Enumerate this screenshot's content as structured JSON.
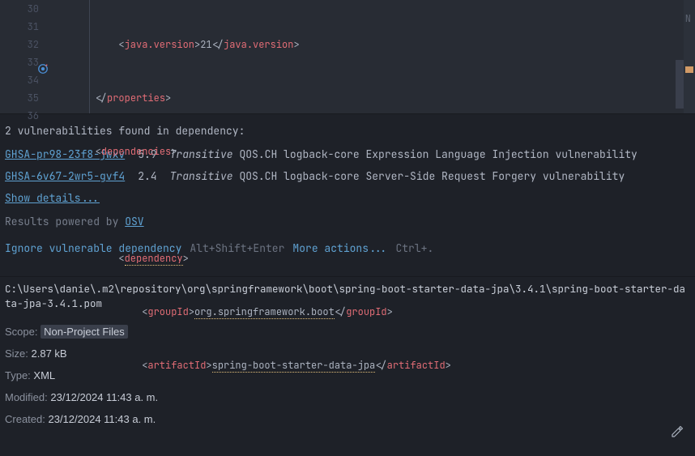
{
  "editor": {
    "lines": [
      {
        "num": "30"
      },
      {
        "num": "31"
      },
      {
        "num": "32"
      },
      {
        "num": "33"
      },
      {
        "num": "34"
      },
      {
        "num": "35"
      },
      {
        "num": "36"
      }
    ],
    "code": {
      "line31_tag": "properties",
      "line32_tag": "dependencies",
      "line34_tag": "dependency",
      "line35_tag": "groupId",
      "line35_text": "org.springframework.boot",
      "line36_tag": "artifactId",
      "line36_text": "spring-boot-starter-data-jpa"
    },
    "miniLabel": "N"
  },
  "vulnerability": {
    "header": "2 vulnerabilities found in dependency:",
    "items": [
      {
        "id": "GHSA-pr98-23f8-jwxv",
        "score": "5.9",
        "transitive": "Transitive",
        "desc": "QOS.CH logback-core Expression Language Injection vulnerability"
      },
      {
        "id": "GHSA-6v67-2wr5-gvf4",
        "score": "2.4",
        "transitive": "Transitive",
        "desc": "QOS.CH logback-core Server-Side Request Forgery vulnerability"
      }
    ],
    "showDetails": "Show details...",
    "poweredByText": "Results powered by ",
    "poweredByLink": "OSV",
    "ignoreAction": "Ignore vulnerable dependency",
    "ignoreShortcut": "Alt+Shift+Enter",
    "moreActions": "More actions...",
    "moreShortcut": "Ctrl+."
  },
  "fileInfo": {
    "path": "C:\\Users\\danie\\.m2\\repository\\org\\springframework\\boot\\spring-boot-starter-data-jpa\\3.4.1\\spring-boot-starter-data-jpa-3.4.1.pom",
    "scopeLabel": "Scope: ",
    "scopeValue": "Non-Project Files",
    "sizeLabel": "Size: ",
    "sizeValue": "2.87 kB",
    "typeLabel": "Type: ",
    "typeValue": "XML",
    "modifiedLabel": "Modified: ",
    "modifiedValue": "23/12/2024 11:43 a. m.",
    "createdLabel": "Created: ",
    "createdValue": "23/12/2024 11:43 a. m."
  }
}
